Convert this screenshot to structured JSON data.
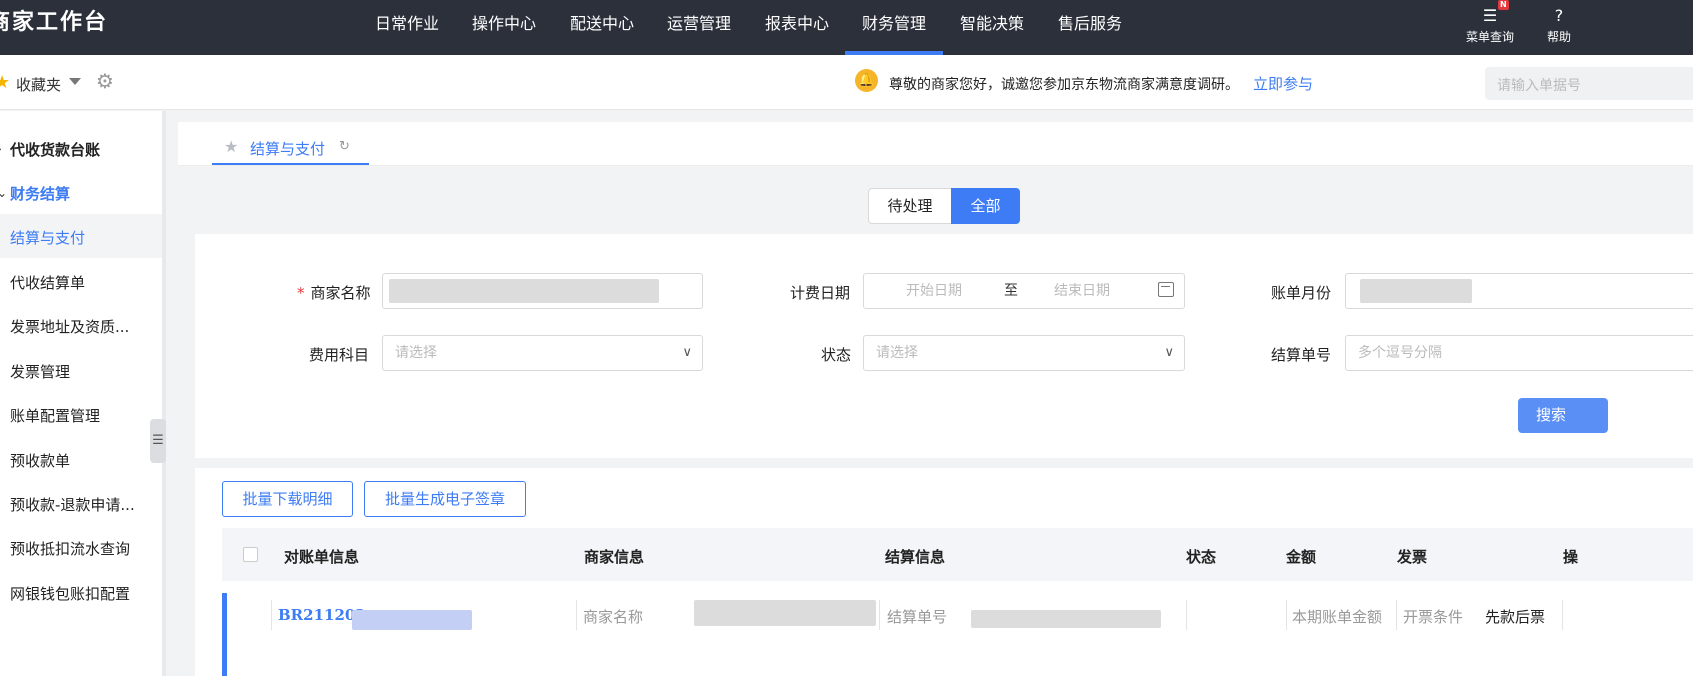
{
  "app": {
    "title": "商家工作台"
  },
  "topnav": {
    "items": [
      "日常作业",
      "操作中心",
      "配送中心",
      "运营管理",
      "报表中心",
      "财务管理",
      "智能决策",
      "售后服务"
    ],
    "active": "财务管理"
  },
  "top_tools": {
    "menu_search": "菜单查询",
    "menu_search_badge": "N",
    "help": "帮助"
  },
  "subbar": {
    "favorites": "收藏夹",
    "notice": "尊敬的商家您好，诚邀您参加京东物流商家满意度调研。",
    "notice_link": "立即参与",
    "search_placeholder": "请输入单据号"
  },
  "sidebar": {
    "group1": "代收货款台账",
    "group2": "财务结算",
    "items": [
      "结算与支付",
      "代收结算单",
      "发票地址及资质...",
      "发票管理",
      "账单配置管理",
      "预收款单",
      "预收款-退款申请...",
      "预收抵扣流水查询",
      "网银钱包账扣配置"
    ],
    "active_item": "结算与支付"
  },
  "page_tab": {
    "label": "结算与支付"
  },
  "segment": {
    "pending": "待处理",
    "all": "全部",
    "active": "全部"
  },
  "form": {
    "merchant_name_label": "商家名称",
    "fee_date_label": "计费日期",
    "date_start_placeholder": "开始日期",
    "date_sep": "至",
    "date_end_placeholder": "结束日期",
    "bill_month_label": "账单月份",
    "fee_item_label": "费用科目",
    "fee_item_placeholder": "请选择",
    "status_label": "状态",
    "status_placeholder": "请选择",
    "settle_no_label": "结算单号",
    "settle_no_placeholder": "多个逗号分隔",
    "search_button": "搜索"
  },
  "actions": {
    "batch_download": "批量下载明细",
    "batch_seal": "批量生成电子签章"
  },
  "table": {
    "columns": [
      "对账单信息",
      "商家信息",
      "结算信息",
      "状态",
      "金额",
      "发票",
      "操"
    ],
    "rows": [
      {
        "statement_no": "BR211202",
        "merchant_label": "商家名称",
        "settle_label": "结算单号",
        "amount_label": "本期账单金额",
        "invoice_label": "开票条件",
        "invoice_value": "先款后票"
      }
    ]
  },
  "colors": {
    "accent": "#3d7cf4",
    "topbar": "#2b303b"
  }
}
